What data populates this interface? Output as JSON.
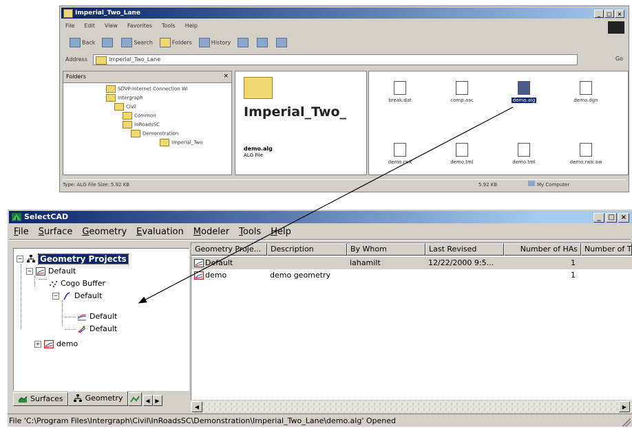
{
  "explorer": {
    "title": "Imperial_Two_Lane",
    "menu": [
      "File",
      "Edit",
      "View",
      "Favorites",
      "Tools",
      "Help"
    ],
    "toolbar": [
      "Back",
      "Search",
      "Folders",
      "History"
    ],
    "address_label": "Address",
    "address_value": "Imperial_Two_Lane",
    "go_label": "Go",
    "folders_header": "Folders",
    "folder_tree": [
      "SDVP-Internet Connection Wi",
      "Intergraph",
      "Civil",
      "Common",
      "InRoadsSC",
      "Demonstration",
      "Imperial_Two"
    ],
    "preview_title": "Imperial_Two_",
    "preview_file_name": "demo.alg",
    "preview_file_type": "ALG File",
    "files": [
      "break.dat",
      "comp.asc",
      "demo.alg",
      "demo.dgn",
      "demo.rwk",
      "demo.tml",
      "demo.tml",
      "demo.rwk.aw"
    ],
    "status_left": "Type: ALG File Size: 5.92 KB",
    "status_mid": "5.92 KB",
    "status_right": "My Computer"
  },
  "selectcad": {
    "title": "SelectCAD",
    "menu": {
      "file": {
        "u": "F",
        "rest": "ile"
      },
      "surface": {
        "u": "S",
        "rest": "urface"
      },
      "geometry": {
        "u": "G",
        "rest": "eometry"
      },
      "evaluation": {
        "u": "E",
        "rest": "valuation"
      },
      "modeler": {
        "u": "M",
        "rest": "odeler"
      },
      "tools": {
        "u": "T",
        "rest": "ools"
      },
      "help": {
        "u": "H",
        "rest": "elp"
      }
    },
    "tree": {
      "root": "Geometry Projects",
      "default_project": "Default",
      "cogo_buffer": "Cogo Buffer",
      "alignment": "Default",
      "child1": "Default",
      "child2": "Default",
      "demo": "demo"
    },
    "tabs": {
      "surfaces": "Surfaces",
      "geometry": "Geometry"
    },
    "columns": [
      "Geometry Proje...",
      "Description",
      "By Whom",
      "Last Revised",
      "Number of HAs",
      "Number of T"
    ],
    "rows": [
      {
        "project": "Default",
        "description": "",
        "by_whom": "lahamilt",
        "last_revised": "12/22/2000 9:5...",
        "num_has": "1"
      },
      {
        "project": "demo",
        "description": "demo geometry",
        "by_whom": "",
        "last_revised": "",
        "num_has": "1"
      }
    ],
    "status": "File 'C:\\Program Files\\Intergraph\\Civil\\InRoadsSC\\Demonstration\\Imperial_Two_Lane\\demo.alg' Opened"
  },
  "colors": {
    "title_active": "#0a246a",
    "selection": "#0a246a",
    "face": "#d4d0c8"
  }
}
